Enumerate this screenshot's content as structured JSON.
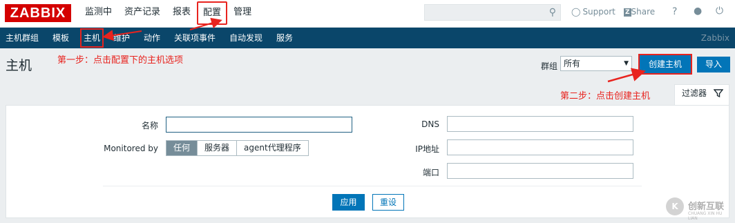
{
  "header": {
    "logo": "ZABBIX",
    "menu": [
      "监测中",
      "资产记录",
      "报表",
      "配置",
      "管理"
    ],
    "active_menu_index": 3,
    "search_placeholder": "",
    "support": "Support",
    "share_box": "Z",
    "share": "Share",
    "help": "?",
    "user_icon": "user-icon",
    "power_icon": "power-icon"
  },
  "subnav": {
    "items": [
      "主机群组",
      "模板",
      "主机",
      "维护",
      "动作",
      "关联项事件",
      "自动发现",
      "服务"
    ],
    "active_index": 2,
    "brand": "Zabbix"
  },
  "page": {
    "title": "主机",
    "annotation_step1": "第一步：点击配置下的主机选项",
    "annotation_step2": "第二步：点击创建主机",
    "group_label": "群组",
    "group_value": "所有",
    "create_button": "创建主机",
    "import_button": "导入"
  },
  "filter": {
    "tab_label": "过滤器",
    "name_label": "名称",
    "name_value": "",
    "monitored_by_label": "Monitored by",
    "monitored_options": [
      "任何",
      "服务器",
      "agent代理程序"
    ],
    "monitored_selected_index": 0,
    "dns_label": "DNS",
    "dns_value": "",
    "ip_label": "IP地址",
    "ip_value": "",
    "port_label": "端口",
    "port_value": "",
    "apply_button": "应用",
    "reset_button": "重设"
  },
  "watermark": {
    "symbol": "K",
    "text": "创新互联",
    "subtext": "CHUANG XIN HU LIAN"
  },
  "colors": {
    "accent_red": "#e8231e",
    "nav_blue": "#0a466a",
    "button_blue": "#0275b8",
    "logo_red": "#d40000"
  }
}
